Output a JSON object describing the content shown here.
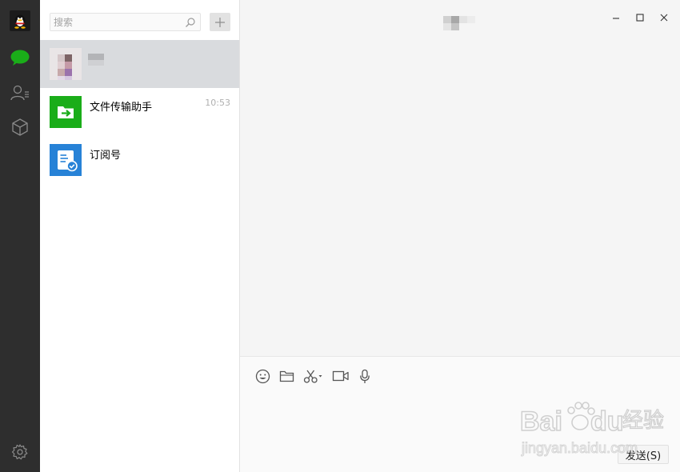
{
  "sidebar": {
    "nav_items": [
      {
        "icon": "chat-bubble-icon",
        "active": true
      },
      {
        "icon": "contacts-icon",
        "active": false
      },
      {
        "icon": "favorites-box-icon",
        "active": false
      }
    ],
    "settings_icon": "gear-icon"
  },
  "search": {
    "placeholder": "搜索"
  },
  "chats": [
    {
      "name": "",
      "time": "",
      "icon": "blurred-avatar"
    },
    {
      "name": "文件传输助手",
      "time": "10:53",
      "icon": "file-transfer-icon"
    },
    {
      "name": "订阅号",
      "time": "",
      "icon": "subscription-icon"
    }
  ],
  "composer": {
    "tools": [
      "emoji-icon",
      "folder-icon",
      "scissors-icon",
      "video-icon",
      "microphone-icon"
    ],
    "send_label": "发送(S)"
  },
  "watermark": {
    "brand": "Bai",
    "brand_tail": "du",
    "cn": "经验",
    "url": "jingyan.baidu.com"
  },
  "colors": {
    "accent_green": "#1aad19",
    "subscription_blue": "#2782d7",
    "nav_bg": "#2e2e2e"
  }
}
